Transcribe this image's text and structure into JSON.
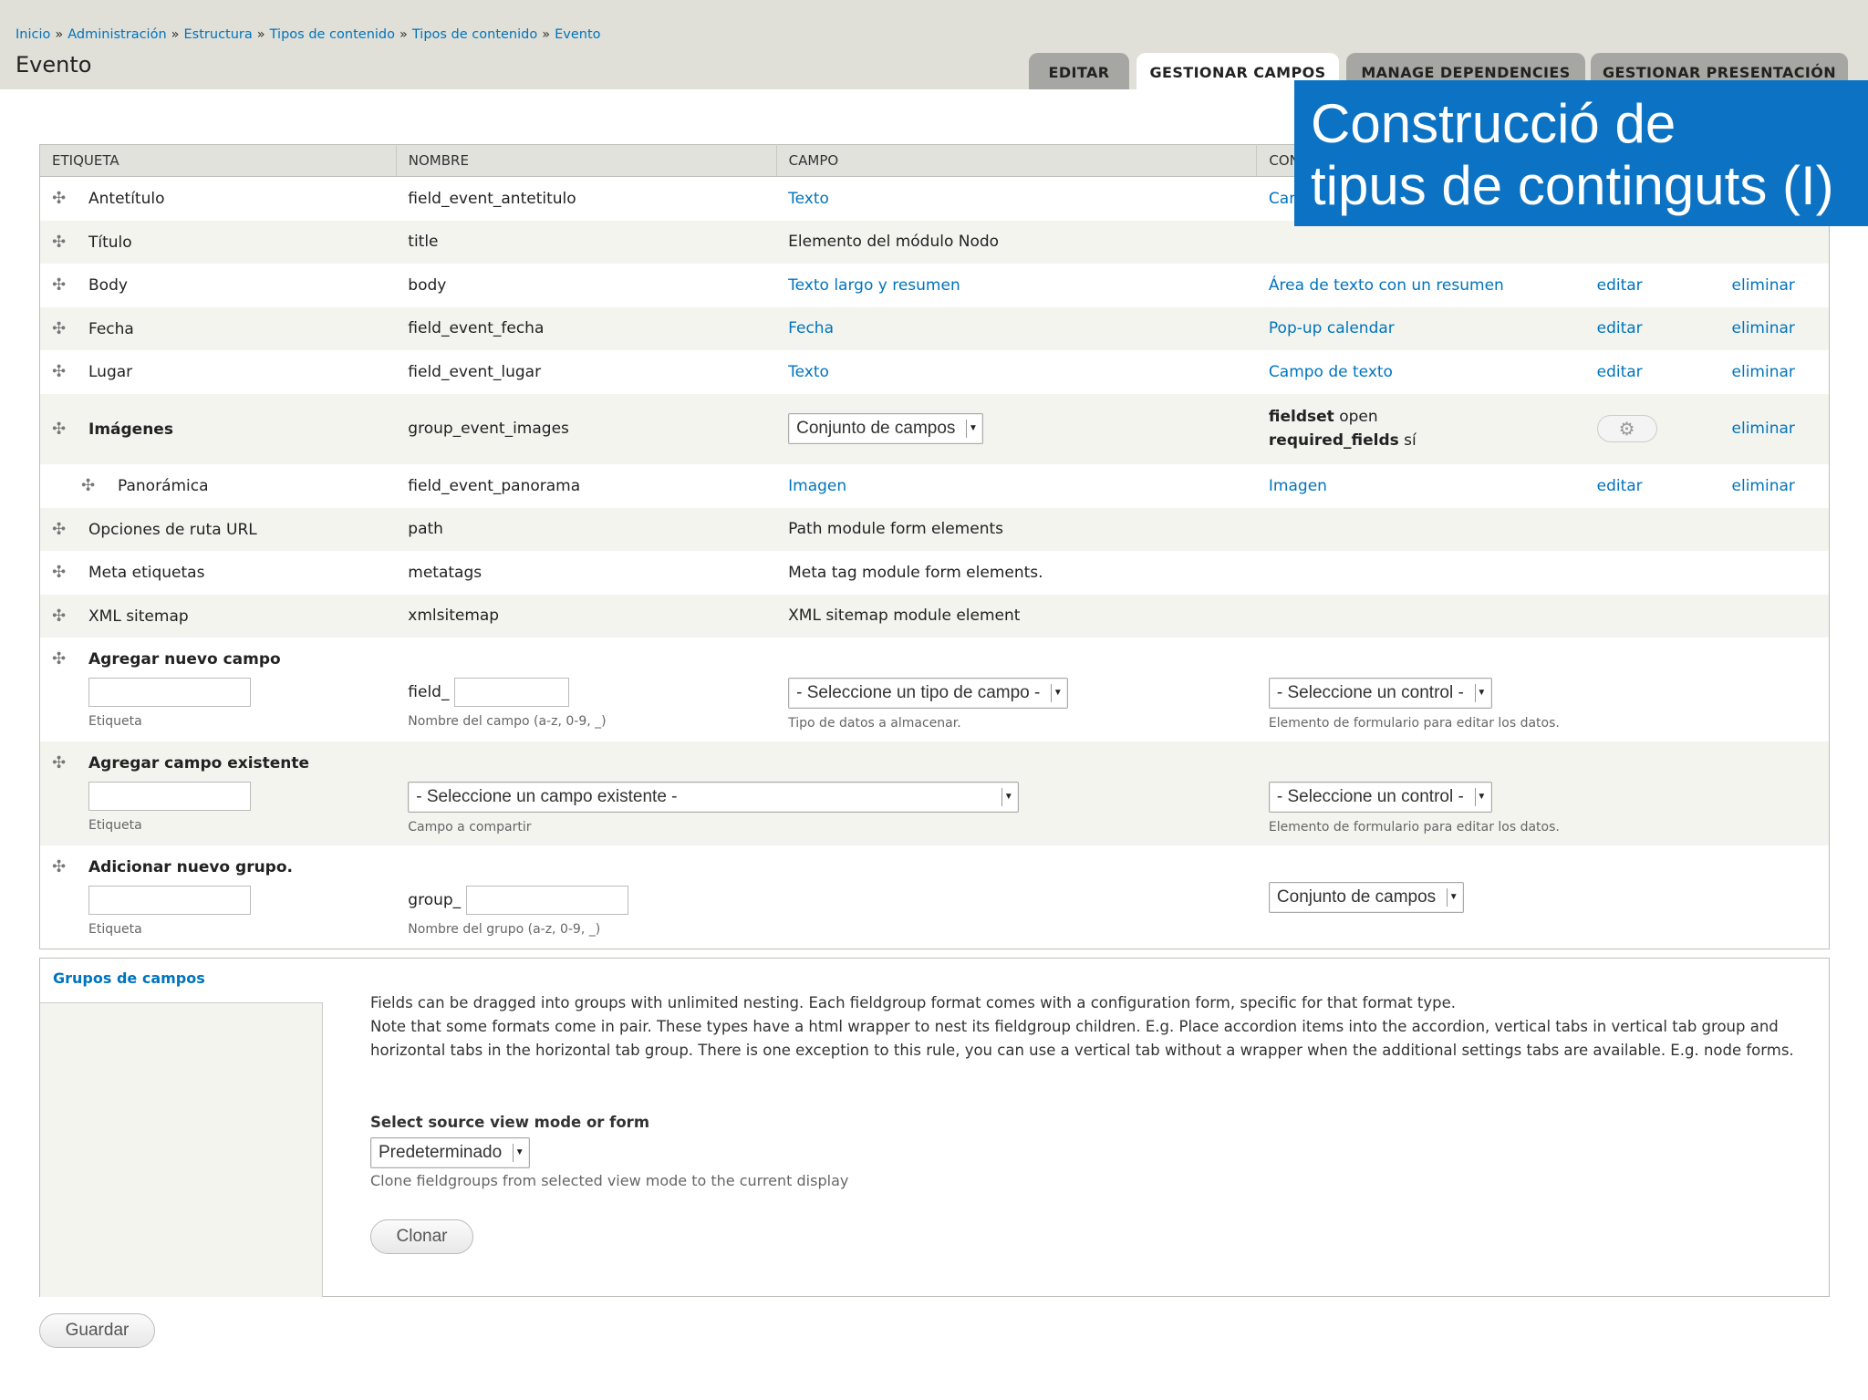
{
  "breadcrumb": [
    "Inicio",
    "Administración",
    "Estructura",
    "Tipos de contenido",
    "Tipos de contenido",
    "Evento"
  ],
  "breadcrumb_separator": "»",
  "page_title": "Evento",
  "tabs": [
    "EDITAR",
    "GESTIONAR CAMPOS",
    "MANAGE DEPENDENCIES",
    "GESTIONAR PRESENTACIÓN"
  ],
  "active_tab": "GESTIONAR CAMPOS",
  "banner": {
    "line1": "Construcció de",
    "line2": "tipus de continguts (I)",
    "color": "#0b72c4"
  },
  "table": {
    "headers": [
      "ETIQUETA",
      "NOMBRE",
      "CAMPO",
      "CON"
    ],
    "rows": [
      {
        "label": "Antetítulo",
        "name": "field_event_antetitulo",
        "field": "Texto",
        "widget": "Can",
        "edit": "",
        "delete": ""
      },
      {
        "label": "Título",
        "name": "title",
        "field": "Elemento del módulo Nodo",
        "widget": "",
        "edit": "",
        "delete": ""
      },
      {
        "label": "Body",
        "name": "body",
        "field": "Texto largo y resumen",
        "widget": "Área de texto con un resumen",
        "edit": "editar",
        "delete": "eliminar"
      },
      {
        "label": "Fecha",
        "name": "field_event_fecha",
        "field": "Fecha",
        "widget": "Pop-up calendar",
        "edit": "editar",
        "delete": "eliminar"
      },
      {
        "label": "Lugar",
        "name": "field_event_lugar",
        "field": "Texto",
        "widget": "Campo de texto",
        "edit": "editar",
        "delete": "eliminar"
      },
      {
        "label": "Imágenes",
        "name": "group_event_images",
        "field_select": "Conjunto de campos",
        "widget_key1": "fieldset",
        "widget_val1": "open",
        "widget_key2": "required_fields",
        "widget_val2": "sí",
        "delete": "eliminar"
      },
      {
        "label": "Panorámica",
        "name": "field_event_panorama",
        "field": "Imagen",
        "widget": "Imagen",
        "edit": "editar",
        "delete": "eliminar"
      },
      {
        "label": "Opciones de ruta URL",
        "name": "path",
        "field": "Path module form elements"
      },
      {
        "label": "Meta etiquetas",
        "name": "metatags",
        "field": "Meta tag module form elements."
      },
      {
        "label": "XML sitemap",
        "name": "xmlsitemap",
        "field": "XML sitemap module element"
      }
    ],
    "add_new_field": {
      "title": "Agregar nuevo campo",
      "label_desc": "Etiqueta",
      "name_prefix": "field_",
      "name_desc": "Nombre del campo (a-z, 0-9, _)",
      "type_select": "- Seleccione un tipo de campo -",
      "type_desc": "Tipo de datos a almacenar.",
      "widget_select": "- Seleccione un control -",
      "widget_desc": "Elemento de formulario para editar los datos."
    },
    "add_existing_field": {
      "title": "Agregar campo existente",
      "label_desc": "Etiqueta",
      "field_select": "- Seleccione un campo existente -",
      "field_desc": "Campo a compartir",
      "widget_select": "- Seleccione un control -",
      "widget_desc": "Elemento de formulario para editar los datos."
    },
    "add_new_group": {
      "title": "Adicionar nuevo grupo.",
      "label_desc": "Etiqueta",
      "name_prefix": "group_",
      "name_desc": "Nombre del grupo (a-z, 0-9, _)",
      "format_select": "Conjunto de campos"
    }
  },
  "field_groups": {
    "title": "Grupos de campos",
    "paragraph1": "Fields can be dragged into groups with unlimited nesting. Each fieldgroup format comes with a configuration form, specific for that format type.",
    "paragraph2": "Note that some formats come in pair. These types have a html wrapper to nest its fieldgroup children. E.g. Place accordion items into the accordion, vertical tabs in vertical tab group and horizontal tabs in the horizontal tab group. There is one exception to this rule, you can use a vertical tab without a wrapper when the additional settings tabs are available. E.g. node forms.",
    "source_label": "Select source view mode or form",
    "source_select": "Predeterminado",
    "clone_desc": "Clone fieldgroups from selected view mode to the current display",
    "clone_button": "Clonar"
  },
  "save_button": "Guardar",
  "drag_icon": "✣"
}
